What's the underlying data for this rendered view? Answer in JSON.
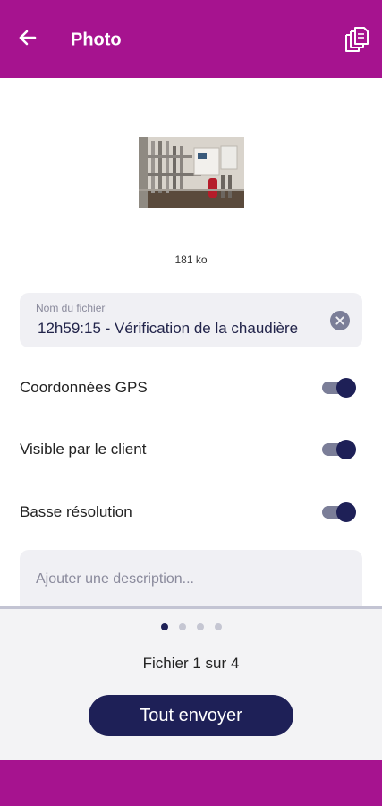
{
  "header": {
    "title": "Photo",
    "back_icon": "arrow-left-icon",
    "files_icon": "file-stack-icon",
    "background": "#a6138f"
  },
  "photo": {
    "size_label": "181 ko"
  },
  "filename_field": {
    "label": "Nom du fichier",
    "value": "12h59:15 - Vérification de la chaudière"
  },
  "toggles": [
    {
      "label": "Coordonnées GPS",
      "on": true
    },
    {
      "label": "Visible par le client",
      "on": true
    },
    {
      "label": "Basse résolution",
      "on": true
    }
  ],
  "description": {
    "placeholder": "Ajouter une description..."
  },
  "pager": {
    "current": 1,
    "total": 4,
    "counter_label": "Fichier 1 sur 4"
  },
  "actions": {
    "send_all_label": "Tout envoyer"
  },
  "colors": {
    "accent": "#a6138f",
    "primary": "#1e2057",
    "field_bg": "#f0f0f4"
  }
}
